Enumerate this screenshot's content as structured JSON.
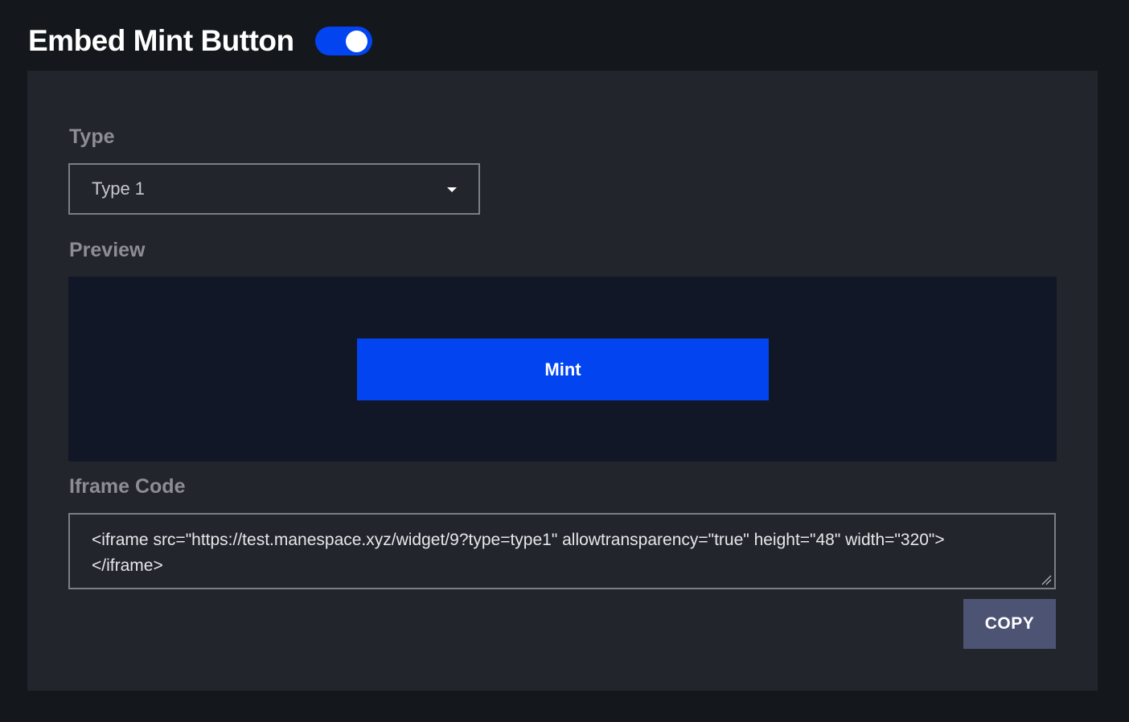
{
  "header": {
    "title": "Embed Mint Button",
    "toggle_on": true
  },
  "type_section": {
    "label": "Type",
    "selected": "Type 1"
  },
  "preview_section": {
    "label": "Preview",
    "mint_label": "Mint"
  },
  "iframe_section": {
    "label": "Iframe Code",
    "code": "<iframe src=\"https://test.manespace.xyz/widget/9?type=type1\" allowtransparency=\"true\" height=\"48\" width=\"320\"></iframe>",
    "copy_label": "COPY"
  },
  "colors": {
    "page_bg": "#14171b",
    "card_bg": "#22252c",
    "accent": "#0244f0",
    "preview_bg": "#111727",
    "copy_bg": "#4d5473"
  }
}
